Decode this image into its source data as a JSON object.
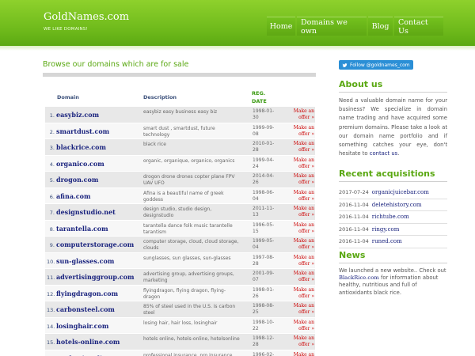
{
  "header": {
    "title": "GoldNames.com",
    "subtitle": "WE LIKE DOMAINS!",
    "nav": [
      "Home",
      "Domains we own",
      "Blog",
      "Contact Us"
    ]
  },
  "main": {
    "heading": "Browse our domains which are for sale",
    "columns": {
      "domain": "Domain",
      "description": "Description",
      "reg_line1": "REG.",
      "reg_line2": "DATE"
    },
    "rows": [
      {
        "n": "1.",
        "domain": "easybiz.com",
        "desc1": "easybiz easy business easy biz",
        "desc2": "",
        "date1": "1998-01-",
        "date2": "30",
        "offer1": "Make an",
        "offer2": "offer »"
      },
      {
        "n": "2.",
        "domain": "smartdust.com",
        "desc1": "smart dust , smartdust, future",
        "desc2": "technology",
        "date1": "1999-09-",
        "date2": "08",
        "offer1": "Make an",
        "offer2": "offer »"
      },
      {
        "n": "3.",
        "domain": "blackrice.com",
        "desc1": "black rice",
        "desc2": "",
        "date1": "2010-01-",
        "date2": "28",
        "offer1": "Make an",
        "offer2": "offer »"
      },
      {
        "n": "4.",
        "domain": "organico.com",
        "desc1": "organic, organique, organico, organics",
        "desc2": "",
        "date1": "1999-04-",
        "date2": "24",
        "offer1": "Make an",
        "offer2": "offer »"
      },
      {
        "n": "5.",
        "domain": "drogon.com",
        "desc1": "drogon drone drones copter plane FPV",
        "desc2": "UAV UFO",
        "date1": "2014-04-",
        "date2": "26",
        "offer1": "Make an",
        "offer2": "offer »"
      },
      {
        "n": "6.",
        "domain": "afina.com",
        "desc1": "Afina is a beautiful name of greek",
        "desc2": "goddess",
        "date1": "1998-06-",
        "date2": "04",
        "offer1": "Make an",
        "offer2": "offer »"
      },
      {
        "n": "7.",
        "domain": "designstudio.net",
        "desc1": "design studio, studio design,",
        "desc2": "designstudio",
        "date1": "2011-11-",
        "date2": "13",
        "offer1": "Make an",
        "offer2": "offer »"
      },
      {
        "n": "8.",
        "domain": "tarantella.com",
        "desc1": "tarantella dance folk music tarantelle",
        "desc2": "tarantism",
        "date1": "1996-05-",
        "date2": "15",
        "offer1": "Make an",
        "offer2": "offer »"
      },
      {
        "n": "9.",
        "domain": "computerstorage.com",
        "desc1": "computer storage, cloud, cloud storage,",
        "desc2": "clouds",
        "date1": "1999-05-",
        "date2": "04",
        "offer1": "Make an",
        "offer2": "offer »"
      },
      {
        "n": "10.",
        "domain": "sun-glasses.com",
        "desc1": "sunglasses, sun glasses, sun-glasses",
        "desc2": "",
        "date1": "1997-08-",
        "date2": "28",
        "offer1": "Make an",
        "offer2": "offer »"
      },
      {
        "n": "11.",
        "domain": "advertisinggroup.com",
        "desc1": "advertising group, advertising groups,",
        "desc2": "marketing",
        "date1": "2001-09-",
        "date2": "07",
        "offer1": "Make an",
        "offer2": "offer »"
      },
      {
        "n": "12.",
        "domain": "flyingdragon.com",
        "desc1": "flyingdragon, flying dragon, flying-",
        "desc2": "dragon",
        "date1": "1998-01-",
        "date2": "26",
        "offer1": "Make an",
        "offer2": "offer »"
      },
      {
        "n": "13.",
        "domain": "carbonsteel.com",
        "desc1": "85% of steel used in the U.S. is carbon",
        "desc2": "steel",
        "date1": "1998-08-",
        "date2": "25",
        "offer1": "Make an",
        "offer2": "offer »"
      },
      {
        "n": "14.",
        "domain": "losinghair.com",
        "desc1": "losing hair, hair loss, losinghair",
        "desc2": "",
        "date1": "1998-10-",
        "date2": "22",
        "offer1": "Make an",
        "offer2": "offer »"
      },
      {
        "n": "15.",
        "domain": "hotels-online.com",
        "desc1": "hotels online, hotels-online, hotelsonline",
        "desc2": "",
        "date1": "1998-12-",
        "date2": "28",
        "offer1": "Make an",
        "offer2": "offer »"
      },
      {
        "n": "16.",
        "domain": "professionalins...",
        "desc1": "professional insurance, pro insurance",
        "desc2": "",
        "date1": "1996-02-",
        "date2": "",
        "offer1": "Make an",
        "offer2": ""
      }
    ]
  },
  "sidebar": {
    "twitter_label": "Follow @goldnames_com",
    "about_heading": "About us",
    "about_text": "Need a valuable domain name for your business? We specialize in domain name trading and have acquired some premium domains. Please take a look at our domain name portfolio and if something catches your eye, don't hesitate to",
    "about_link": "contact us",
    "about_end": ".",
    "acq_heading": "Recent acquisitions",
    "acquisitions": [
      {
        "date": "2017-07-24",
        "domain": "organicjuicebar.com"
      },
      {
        "date": "2016-11-04",
        "domain": "deletehistory.com"
      },
      {
        "date": "2016-11-04",
        "domain": "richtube.com"
      },
      {
        "date": "2016-11-04",
        "domain": "ringy.com"
      },
      {
        "date": "2016-11-04",
        "domain": "runed.com"
      }
    ],
    "news_heading": "News",
    "news_text1": "We launched a new website.. Check out",
    "news_link": "BlackRice.com",
    "news_text2": "for information about healthy, nutritious and full of antioxidants black rice."
  },
  "colors": {
    "brand_green": "#6cb81a",
    "heading_green": "#5aa812",
    "link_navy": "#1a237e",
    "offer_red": "#cc0000",
    "twitter_blue": "#2b8fd6"
  },
  "icons": {
    "twitter": "twitter-bird-icon"
  }
}
